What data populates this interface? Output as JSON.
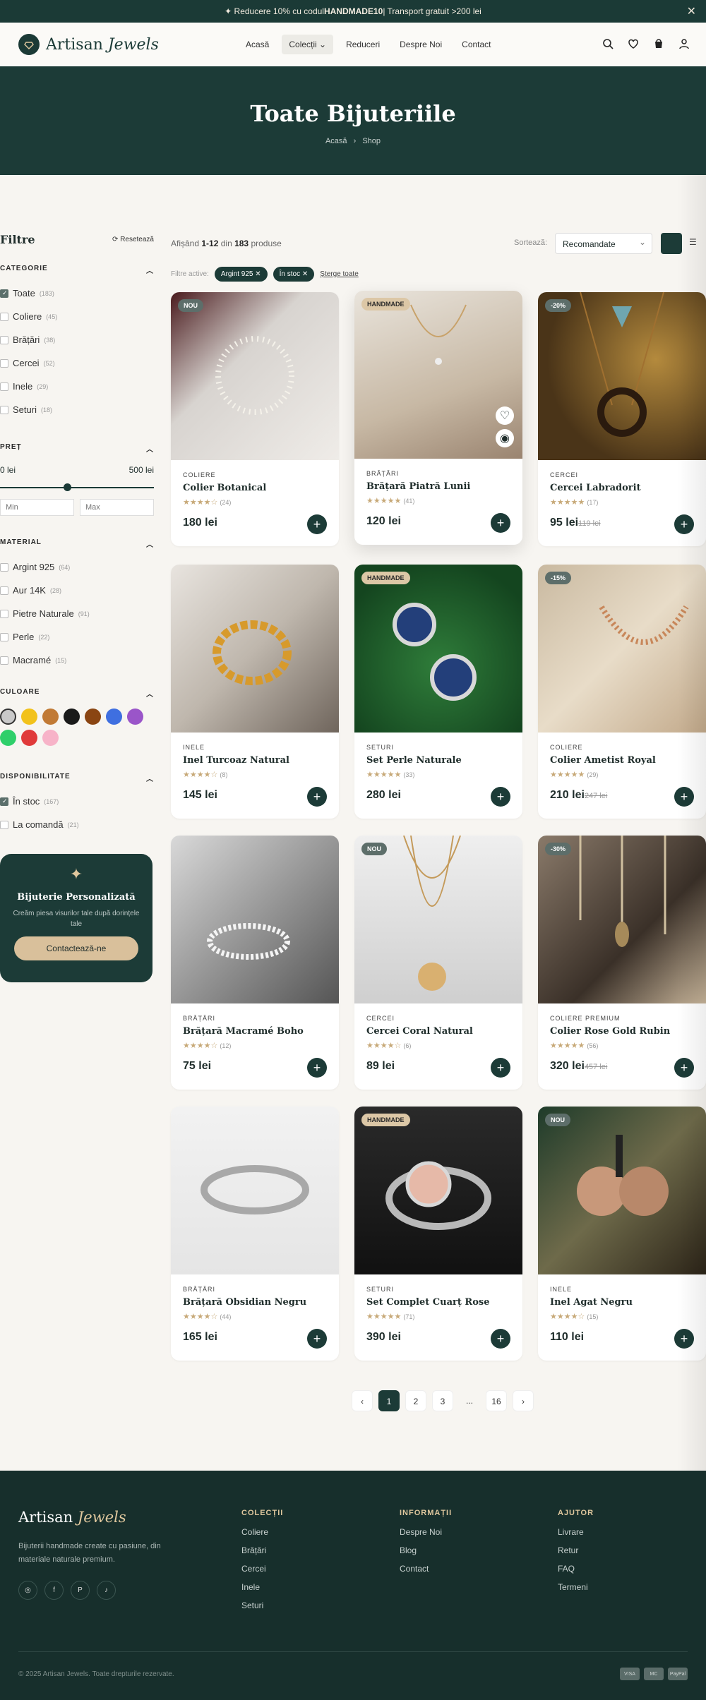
{
  "announcement": {
    "prefix": "✦ Reducere 10% cu codul ",
    "code": "HANDMADE10",
    "suffix": " | Transport gratuit >200 lei",
    "close": "✕"
  },
  "brand": {
    "name": "Artisan",
    "name_accent": "Jewels"
  },
  "nav": [
    {
      "label": "Acasă"
    },
    {
      "label": "Colecții ⌄",
      "active": true
    },
    {
      "label": "Reduceri"
    },
    {
      "label": "Despre Noi"
    },
    {
      "label": "Contact"
    }
  ],
  "hero": {
    "title": "Toate Bijuteriile",
    "crumb_home": "Acasă",
    "crumb_sep": "›",
    "crumb_current": "Shop"
  },
  "filters": {
    "title": "Filtre",
    "reset": "⟳ Resetează",
    "category": {
      "title": "CATEGORIE",
      "items": [
        {
          "label": "Toate",
          "count": "(183)",
          "checked": true
        },
        {
          "label": "Coliere",
          "count": "(45)"
        },
        {
          "label": "Brățări",
          "count": "(38)"
        },
        {
          "label": "Cercei",
          "count": "(52)"
        },
        {
          "label": "Inele",
          "count": "(29)"
        },
        {
          "label": "Seturi",
          "count": "(18)"
        }
      ]
    },
    "price": {
      "title": "PREȚ",
      "min": "0 lei",
      "max": "500 lei",
      "level": 0.45,
      "min_placeholder": "Min",
      "max_placeholder": "Max"
    },
    "material": {
      "title": "MATERIAL",
      "items": [
        {
          "label": "Argint 925",
          "count": "(64)"
        },
        {
          "label": "Aur 14K",
          "count": "(28)"
        },
        {
          "label": "Pietre Naturale",
          "count": "(91)"
        },
        {
          "label": "Perle",
          "count": "(22)"
        },
        {
          "label": "Macramé",
          "count": "(15)"
        }
      ]
    },
    "color": {
      "title": "CULOARE",
      "swatches": [
        "#c9c9c9",
        "#f2c21b",
        "#c17a35",
        "#1a1a1a",
        "#8a4512",
        "#3f6fe0",
        "#9a55c9",
        "#2fcf6a",
        "#e03a3a",
        "#f7b3c8"
      ]
    },
    "availability": {
      "title": "DISPONIBILITATE",
      "items": [
        {
          "label": "În stoc",
          "count": "(167)",
          "checked": true
        },
        {
          "label": "La comandă",
          "count": "(21)"
        }
      ]
    },
    "custom": {
      "title": "Bijuterie Personalizată",
      "text": "Creăm piesa visurilor tale după dorințele tale",
      "button": "Contactează-ne"
    }
  },
  "toolbar": {
    "showing_pre": "Afișând ",
    "showing_range": "1-12",
    "showing_mid": " din ",
    "showing_total": "183",
    "showing_post": " produse",
    "sort_label": "Sortează:",
    "sort_value": "Recomandate"
  },
  "active_filters": {
    "label": "Filtre active:",
    "chips": [
      "Argint 925 ✕",
      "În stoc ✕"
    ],
    "clear": "Șterge toate"
  },
  "products": [
    {
      "badge": "NOU",
      "badge_style": "dk",
      "category": "COLIERE",
      "name": "Colier Botanical",
      "stars": "★★★★☆",
      "reviews": "(24)",
      "price": "180 lei",
      "old_price": ""
    },
    {
      "badge": "HANDMADE",
      "badge_style": "gd",
      "category": "BRĂȚĂRI",
      "name": "Brățară Piatră Lunii",
      "stars": "★★★★★",
      "reviews": "(41)",
      "price": "120 lei",
      "old_price": ""
    },
    {
      "badge": "-20%",
      "badge_style": "dk",
      "category": "CERCEI",
      "name": "Cercei Labradorit",
      "stars": "★★★★★",
      "reviews": "(17)",
      "price": "95 lei",
      "old_price": "119 lei"
    },
    {
      "badge": "",
      "badge_style": "",
      "category": "INELE",
      "name": "Inel Turcoaz Natural",
      "stars": "★★★★☆",
      "reviews": "(8)",
      "price": "145 lei",
      "old_price": ""
    },
    {
      "badge": "HANDMADE",
      "badge_style": "gd",
      "category": "SETURI",
      "name": "Set Perle Naturale",
      "stars": "★★★★★",
      "reviews": "(33)",
      "price": "280 lei",
      "old_price": ""
    },
    {
      "badge": "-15%",
      "badge_style": "dk",
      "category": "COLIERE",
      "name": "Colier Ametist Royal",
      "stars": "★★★★★",
      "reviews": "(29)",
      "price": "210 lei",
      "old_price": "247 lei"
    },
    {
      "badge": "",
      "badge_style": "",
      "category": "BRĂȚĂRI",
      "name": "Brățară Macramé Boho",
      "stars": "★★★★☆",
      "reviews": "(12)",
      "price": "75 lei",
      "old_price": ""
    },
    {
      "badge": "NOU",
      "badge_style": "dk",
      "category": "CERCEI",
      "name": "Cercei Coral Natural",
      "stars": "★★★★☆",
      "reviews": "(6)",
      "price": "89 lei",
      "old_price": ""
    },
    {
      "badge": "-30%",
      "badge_style": "dk",
      "category": "COLIERE PREMIUM",
      "name": "Colier Rose Gold Rubin",
      "stars": "★★★★★",
      "reviews": "(56)",
      "price": "320 lei",
      "old_price": "457 lei"
    },
    {
      "badge": "",
      "badge_style": "",
      "category": "BRĂȚĂRI",
      "name": "Brățară Obsidian Negru",
      "stars": "★★★★☆",
      "reviews": "(44)",
      "price": "165 lei",
      "old_price": ""
    },
    {
      "badge": "HANDMADE",
      "badge_style": "gd",
      "category": "SETURI",
      "name": "Set Complet Cuarț Rose",
      "stars": "★★★★★",
      "reviews": "(71)",
      "price": "390 lei",
      "old_price": ""
    },
    {
      "badge": "NOU",
      "badge_style": "dk",
      "category": "INELE",
      "name": "Inel Agat Negru",
      "stars": "★★★★☆",
      "reviews": "(15)",
      "price": "110 lei",
      "old_price": ""
    }
  ],
  "pagination": {
    "prev": "‹",
    "pages": [
      "1",
      "2",
      "3",
      "...",
      "16"
    ],
    "next": "›"
  },
  "footer": {
    "tagline": "Bijuterii handmade create cu pasiune, din materiale naturale premium.",
    "social": [
      "◎",
      "f",
      "P",
      "♪"
    ],
    "columns": [
      {
        "title": "COLECȚII",
        "links": [
          "Coliere",
          "Brățări",
          "Cercei",
          "Inele",
          "Seturi"
        ]
      },
      {
        "title": "INFORMAȚII",
        "links": [
          "Despre Noi",
          "Blog",
          "Contact"
        ]
      },
      {
        "title": "AJUTOR",
        "links": [
          "Livrare",
          "Retur",
          "FAQ",
          "Termeni"
        ]
      }
    ],
    "copyright": "© 2025 Artisan Jewels. Toate drepturile rezervate.",
    "payments": [
      "VISA",
      "MC",
      "PayPal"
    ]
  }
}
